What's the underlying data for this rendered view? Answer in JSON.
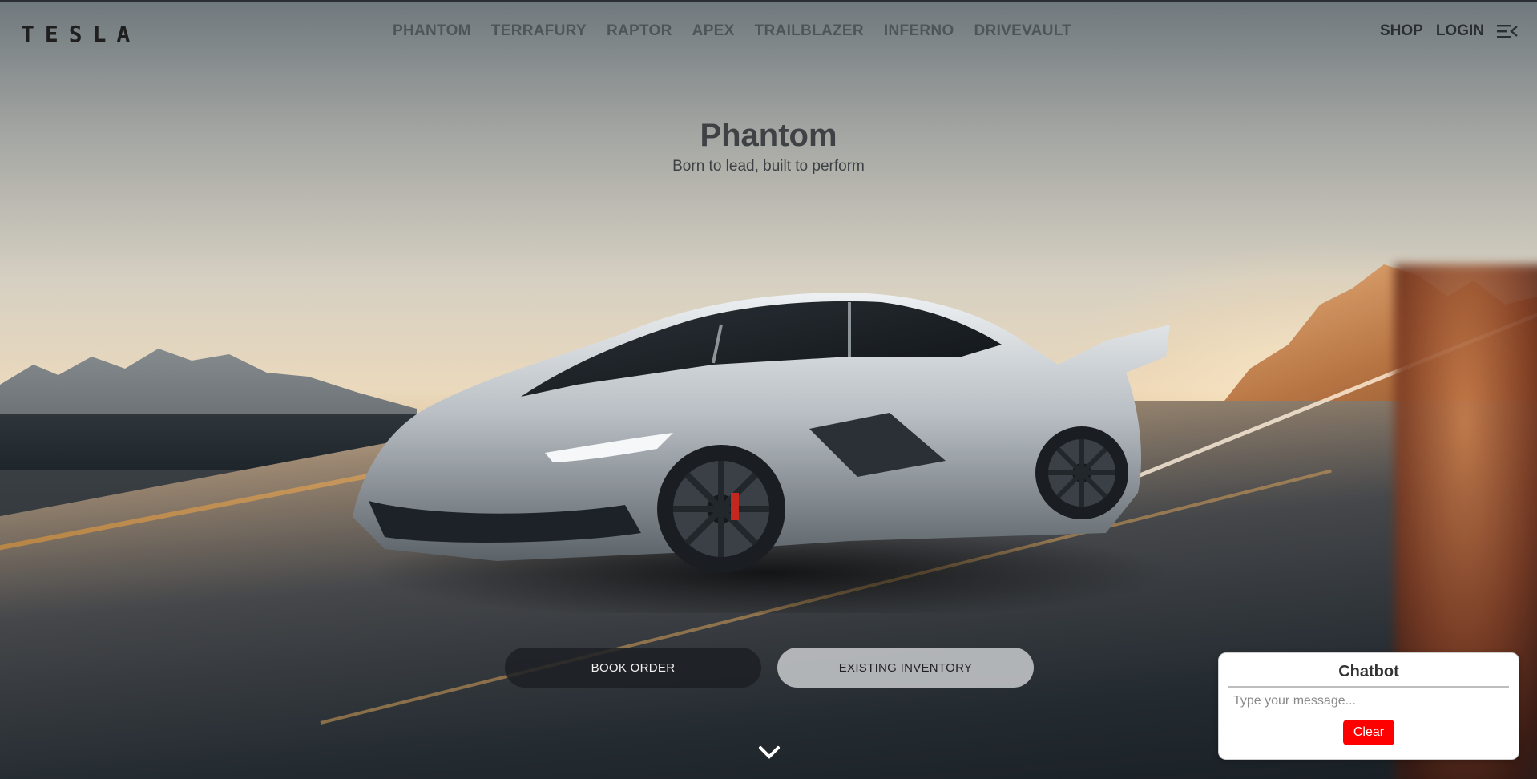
{
  "brand": {
    "logo_text": "TESLA"
  },
  "nav": {
    "models": [
      {
        "label": "PHANTOM"
      },
      {
        "label": "TERRAFURY"
      },
      {
        "label": "RAPTOR"
      },
      {
        "label": "APEX"
      },
      {
        "label": "TRAILBLAZER"
      },
      {
        "label": "INFERNO"
      },
      {
        "label": "DRIVEVAULT"
      }
    ],
    "shop_label": "SHOP",
    "login_label": "LOGIN",
    "menu_icon": "menu-icon"
  },
  "hero": {
    "title": "Phantom",
    "subtitle": "Born to lead, built to perform",
    "book_order_label": "BOOK ORDER",
    "inventory_label": "EXISTING INVENTORY",
    "scroll_icon": "chevron-down-icon"
  },
  "chatbot": {
    "title": "Chatbot",
    "placeholder": "Type your message...",
    "clear_label": "Clear",
    "clear_color": "#ff0000"
  }
}
